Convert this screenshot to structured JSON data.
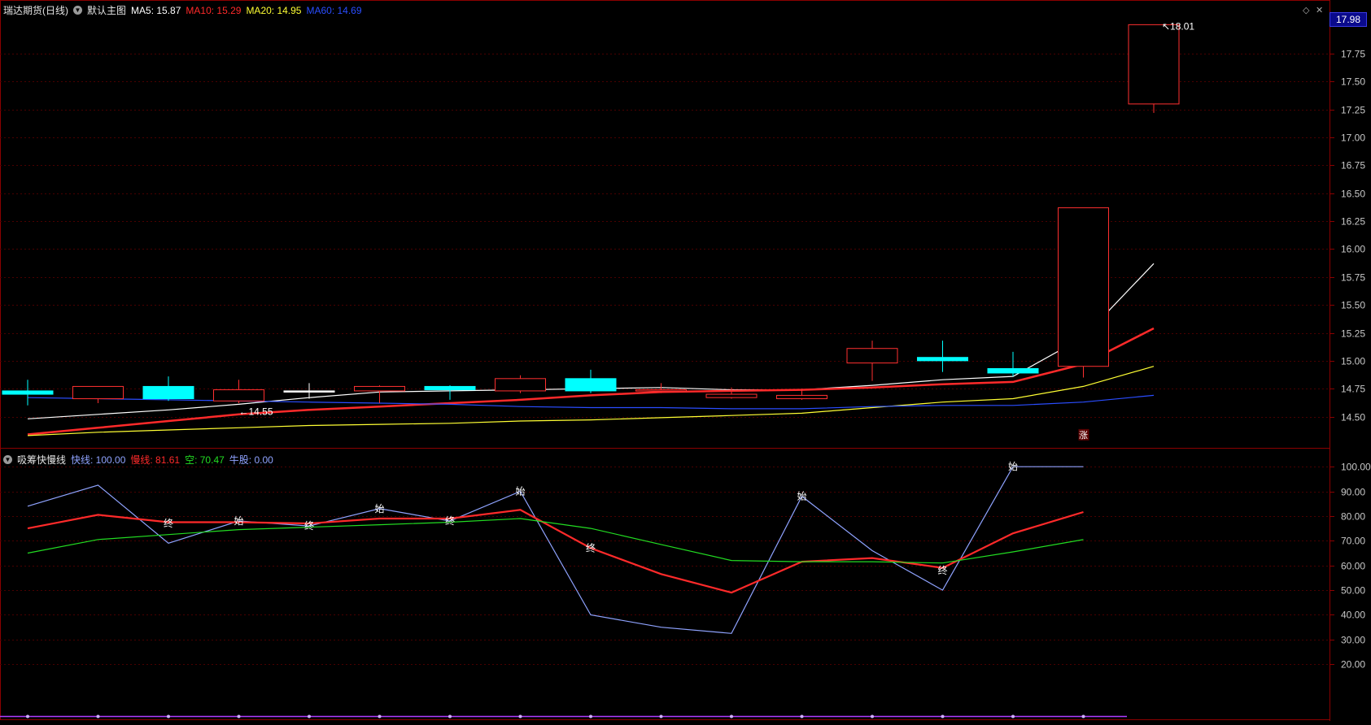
{
  "main_panel": {
    "title": "瑞达期货(日线)",
    "template_label": "默认主图",
    "indicators": [
      {
        "label": "MA5: 15.87",
        "color": "#ffffff"
      },
      {
        "label": "MA10: 15.29",
        "color": "#ff2a2a"
      },
      {
        "label": "MA20: 14.95",
        "color": "#ffff33"
      },
      {
        "label": "MA60: 14.69",
        "color": "#2a4dff"
      }
    ],
    "current_price_badge": "17.98"
  },
  "sub_panel": {
    "title": "吸筹快慢线",
    "indicators": [
      {
        "label": "快线: 100.00",
        "color": "#8fa3ff"
      },
      {
        "label": "慢线: 81.61",
        "color": "#ff2a2a"
      },
      {
        "label": "空: 70.47",
        "color": "#22dd22"
      },
      {
        "label": "牛股: 0.00",
        "color": "#8fa3ff"
      }
    ]
  },
  "chart_data": [
    {
      "type": "candlestick",
      "ylim": [
        14.3,
        18.1
      ],
      "y_ticks": [
        "17.75",
        "17.50",
        "17.25",
        "17.00",
        "16.75",
        "16.50",
        "16.25",
        "16.00",
        "15.75",
        "15.50",
        "15.25",
        "15.00",
        "14.75",
        "14.50"
      ],
      "candles": [
        {
          "open": 14.73,
          "close": 14.7,
          "high": 14.83,
          "low": 14.6,
          "color": "#00ffff"
        },
        {
          "open": 14.66,
          "close": 14.77,
          "high": 14.77,
          "low": 14.62,
          "color": "#ff3030"
        },
        {
          "open": 14.77,
          "close": 14.66,
          "high": 14.86,
          "low": 14.64,
          "color": "#00ffff"
        },
        {
          "open": 14.64,
          "close": 14.74,
          "high": 14.83,
          "low": 14.62,
          "color": "#ff3030"
        },
        {
          "open": 14.73,
          "close": 14.73,
          "high": 14.8,
          "low": 14.66,
          "color": "#ffffff"
        },
        {
          "open": 14.73,
          "close": 14.77,
          "high": 14.78,
          "low": 14.62,
          "color": "#ff3030"
        },
        {
          "open": 14.77,
          "close": 14.74,
          "high": 14.78,
          "low": 14.65,
          "color": "#00ffff"
        },
        {
          "open": 14.73,
          "close": 14.84,
          "high": 14.87,
          "low": 14.71,
          "color": "#ff3030"
        },
        {
          "open": 14.84,
          "close": 14.73,
          "high": 14.92,
          "low": 14.71,
          "color": "#00ffff"
        },
        {
          "open": 14.73,
          "close": 14.74,
          "high": 14.8,
          "low": 14.71,
          "color": "#ff3030"
        },
        {
          "open": 14.67,
          "close": 14.7,
          "high": 14.76,
          "low": 14.66,
          "color": "#ff3030"
        },
        {
          "open": 14.66,
          "close": 14.69,
          "high": 14.75,
          "low": 14.65,
          "color": "#ff3030"
        },
        {
          "open": 14.98,
          "close": 15.11,
          "high": 15.18,
          "low": 14.82,
          "color": "#ff3030"
        },
        {
          "open": 15.03,
          "close": 15.0,
          "high": 15.18,
          "low": 14.9,
          "color": "#00ffff"
        },
        {
          "open": 14.93,
          "close": 14.89,
          "high": 15.08,
          "low": 14.86,
          "color": "#00ffff"
        },
        {
          "open": 14.95,
          "close": 16.37,
          "high": 16.37,
          "low": 14.85,
          "color": "#ff3030"
        },
        {
          "open": 17.3,
          "close": 18.01,
          "high": 18.01,
          "low": 17.22,
          "color": "#ff3030"
        }
      ],
      "ma_series": [
        {
          "name": "MA5",
          "color": "#ffffff",
          "values": [
            14.48,
            14.52,
            14.56,
            14.61,
            14.67,
            14.72,
            14.73,
            14.74,
            14.75,
            14.76,
            14.74,
            14.74,
            14.78,
            14.83,
            14.86,
            15.21,
            15.87
          ]
        },
        {
          "name": "MA10",
          "color": "#ff2a2a",
          "values": [
            14.34,
            14.4,
            14.46,
            14.52,
            14.56,
            14.59,
            14.62,
            14.65,
            14.69,
            14.72,
            14.73,
            14.74,
            14.76,
            14.79,
            14.81,
            14.97,
            15.29
          ]
        },
        {
          "name": "MA20",
          "color": "#ffff33",
          "values": [
            14.33,
            14.36,
            14.38,
            14.4,
            14.42,
            14.43,
            14.44,
            14.46,
            14.47,
            14.49,
            14.51,
            14.53,
            14.58,
            14.63,
            14.66,
            14.77,
            14.95
          ]
        },
        {
          "name": "MA60",
          "color": "#2a4dff",
          "values": [
            14.67,
            14.66,
            14.65,
            14.64,
            14.63,
            14.62,
            14.61,
            14.59,
            14.58,
            14.58,
            14.57,
            14.57,
            14.59,
            14.6,
            14.6,
            14.63,
            14.69
          ]
        }
      ],
      "annotations": [
        {
          "text": "14.55",
          "index": 3,
          "value": 14.55
        },
        {
          "text": "18.01",
          "index": 16,
          "value": 18.01
        },
        {
          "text": "涨",
          "index": 15,
          "value": 14.33
        }
      ]
    },
    {
      "type": "line",
      "ylim": [
        0,
        104
      ],
      "y_ticks": [
        "100.00",
        "90.00",
        "80.00",
        "70.00",
        "60.00",
        "50.00",
        "40.00",
        "30.00",
        "20.00"
      ],
      "series": [
        {
          "name": "快线",
          "color": "#8fa3ff",
          "values": [
            84,
            92.5,
            69,
            78,
            76,
            83,
            78,
            90,
            40,
            35,
            32.5,
            88,
            66,
            50,
            100,
            100
          ]
        },
        {
          "name": "慢线",
          "color": "#ff2a2a",
          "values": [
            75,
            80.5,
            77.5,
            77.5,
            77,
            79,
            79,
            82.5,
            67,
            56.5,
            49,
            61.5,
            63,
            59,
            73,
            81.61
          ]
        },
        {
          "name": "空",
          "color": "#22dd22",
          "values": [
            65,
            70.5,
            72.5,
            74.5,
            75.5,
            76.5,
            77.5,
            79,
            75,
            68.5,
            62,
            61.5,
            61.5,
            61,
            65.5,
            70.47
          ]
        }
      ],
      "markers": [
        {
          "text": "终",
          "index": 2,
          "value": 77
        },
        {
          "text": "始",
          "index": 3,
          "value": 78
        },
        {
          "text": "终",
          "index": 4,
          "value": 76
        },
        {
          "text": "始",
          "index": 5,
          "value": 83
        },
        {
          "text": "终",
          "index": 6,
          "value": 78
        },
        {
          "text": "始",
          "index": 7,
          "value": 90
        },
        {
          "text": "终",
          "index": 8,
          "value": 67
        },
        {
          "text": "始",
          "index": 11,
          "value": 88
        },
        {
          "text": "终",
          "index": 13,
          "value": 58
        },
        {
          "text": "始",
          "index": 14,
          "value": 100
        }
      ]
    }
  ]
}
